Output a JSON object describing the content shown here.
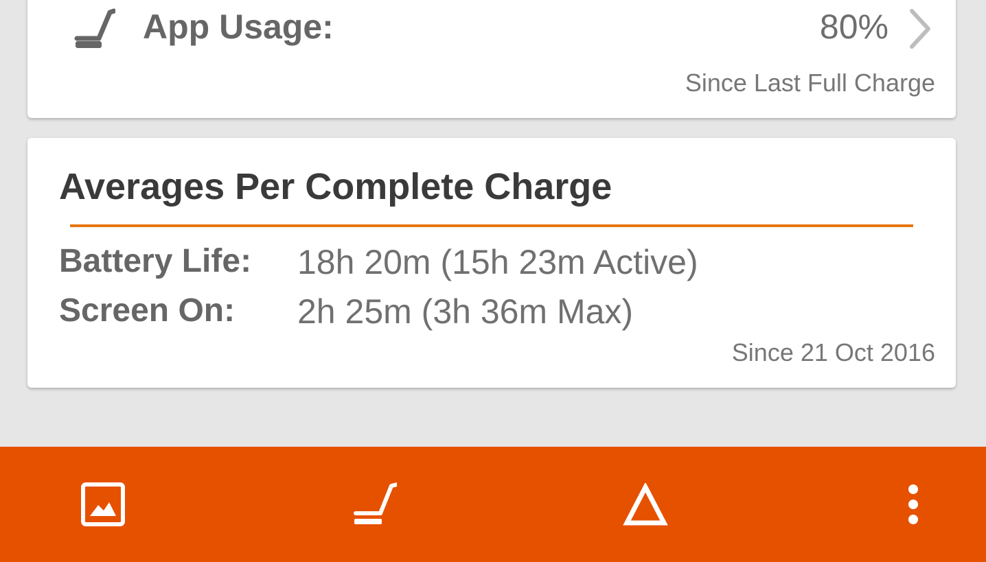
{
  "app_usage": {
    "icon": "app-usage-icon",
    "label": "App Usage:",
    "value": "80%",
    "since": "Since Last Full Charge"
  },
  "averages": {
    "title": "Averages Per Complete Charge",
    "accent_color": "#e8760f",
    "rows": [
      {
        "label": "Battery Life:",
        "value": "18h 20m (15h 23m Active)"
      },
      {
        "label": "Screen On:",
        "value": "2h 25m (3h 36m Max)"
      }
    ],
    "since": "Since 21 Oct 2016"
  },
  "bottom_bar": {
    "color": "#e65100",
    "buttons": [
      "image-icon",
      "app-usage-icon",
      "delta-icon",
      "more-vert-icon"
    ]
  }
}
